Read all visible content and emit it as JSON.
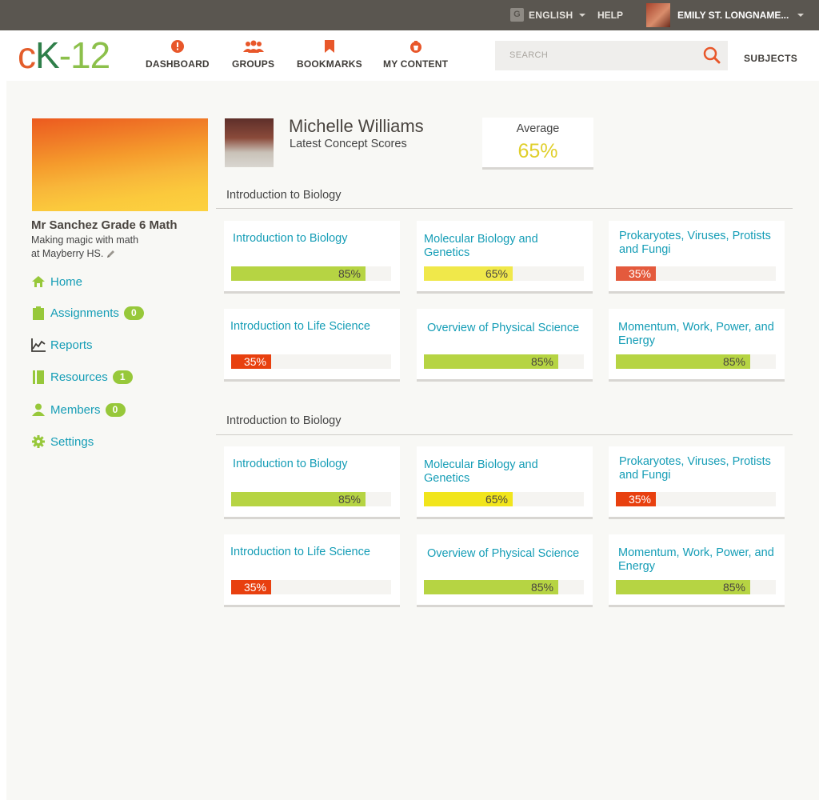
{
  "topbar": {
    "language": "ENGLISH",
    "help": "HELP",
    "user_name": "EMILY ST. LONGNAME..."
  },
  "nav": {
    "logo": {
      "c": "c",
      "k": "K",
      "rest": "-12"
    },
    "items": [
      {
        "label": "DASHBOARD",
        "icon": "dashboard-icon"
      },
      {
        "label": "GROUPS",
        "icon": "groups-icon"
      },
      {
        "label": "BOOKMARKS",
        "icon": "bookmark-icon"
      },
      {
        "label": "MY CONTENT",
        "icon": "my-content-icon"
      }
    ],
    "search_placeholder": "SEARCH",
    "subjects": "SUBJECTS"
  },
  "sidebar": {
    "group_name": "Mr Sanchez Grade 6 Math",
    "desc_line1": "Making magic with math",
    "desc_line2": "at Mayberry HS.",
    "items": [
      {
        "label": "Home",
        "icon": "home-icon"
      },
      {
        "label": "Assignments",
        "icon": "clipboard-icon",
        "badge": "0"
      },
      {
        "label": "Reports",
        "icon": "chart-icon"
      },
      {
        "label": "Resources",
        "icon": "book-icon",
        "badge": "1"
      },
      {
        "label": "Members",
        "icon": "person-icon",
        "badge": "0"
      },
      {
        "label": "Settings",
        "icon": "gear-icon"
      }
    ]
  },
  "profile": {
    "name": "Michelle Williams",
    "subtitle": "Latest Concept Scores",
    "average_label": "Average",
    "average_value": "65%"
  },
  "colors": {
    "accent": "#159db6",
    "high": "#b6d443",
    "mid": "#f0e84a",
    "mid_alt": "#f1e51c",
    "low": "#e45a3d",
    "low_alt": "#e8400f"
  },
  "sections": [
    {
      "title": "Introduction to Biology",
      "cards": [
        {
          "title": "Introduction to Biology",
          "score": 85,
          "score_label": "85%",
          "color": "#b6d443"
        },
        {
          "title": "Molecular Biology and Genetics",
          "score": 65,
          "score_label": "65%",
          "color": "#f0e84a"
        },
        {
          "title": "Prokaryotes, Viruses, Protists and Fungi",
          "score": 35,
          "score_label": "35%",
          "color": "#e45a3d"
        },
        {
          "title": "Introduction to Life Science",
          "score": 35,
          "score_label": "35%",
          "color": "#e8400f"
        },
        {
          "title": "Overview of Physical Science",
          "score": 85,
          "score_label": "85%",
          "color": "#b6d443"
        },
        {
          "title": "Momentum, Work, Power, and Energy",
          "score": 85,
          "score_label": "85%",
          "color": "#b6d443"
        }
      ]
    },
    {
      "title": "Introduction to Biology",
      "cards": [
        {
          "title": "Introduction to Biology",
          "score": 85,
          "score_label": "85%",
          "color": "#b6d443"
        },
        {
          "title": "Molecular Biology and Genetics",
          "score": 65,
          "score_label": "65%",
          "color": "#f1e51c"
        },
        {
          "title": "Prokaryotes, Viruses, Protists and Fungi",
          "score": 35,
          "score_label": "35%",
          "color": "#e8400f"
        },
        {
          "title": "Introduction to Life Science",
          "score": 35,
          "score_label": "35%",
          "color": "#e8400f"
        },
        {
          "title": "Overview of Physical Science",
          "score": 85,
          "score_label": "85%",
          "color": "#b6d443"
        },
        {
          "title": "Momentum, Work, Power, and Energy",
          "score": 85,
          "score_label": "85%",
          "color": "#b6d443"
        }
      ]
    }
  ]
}
